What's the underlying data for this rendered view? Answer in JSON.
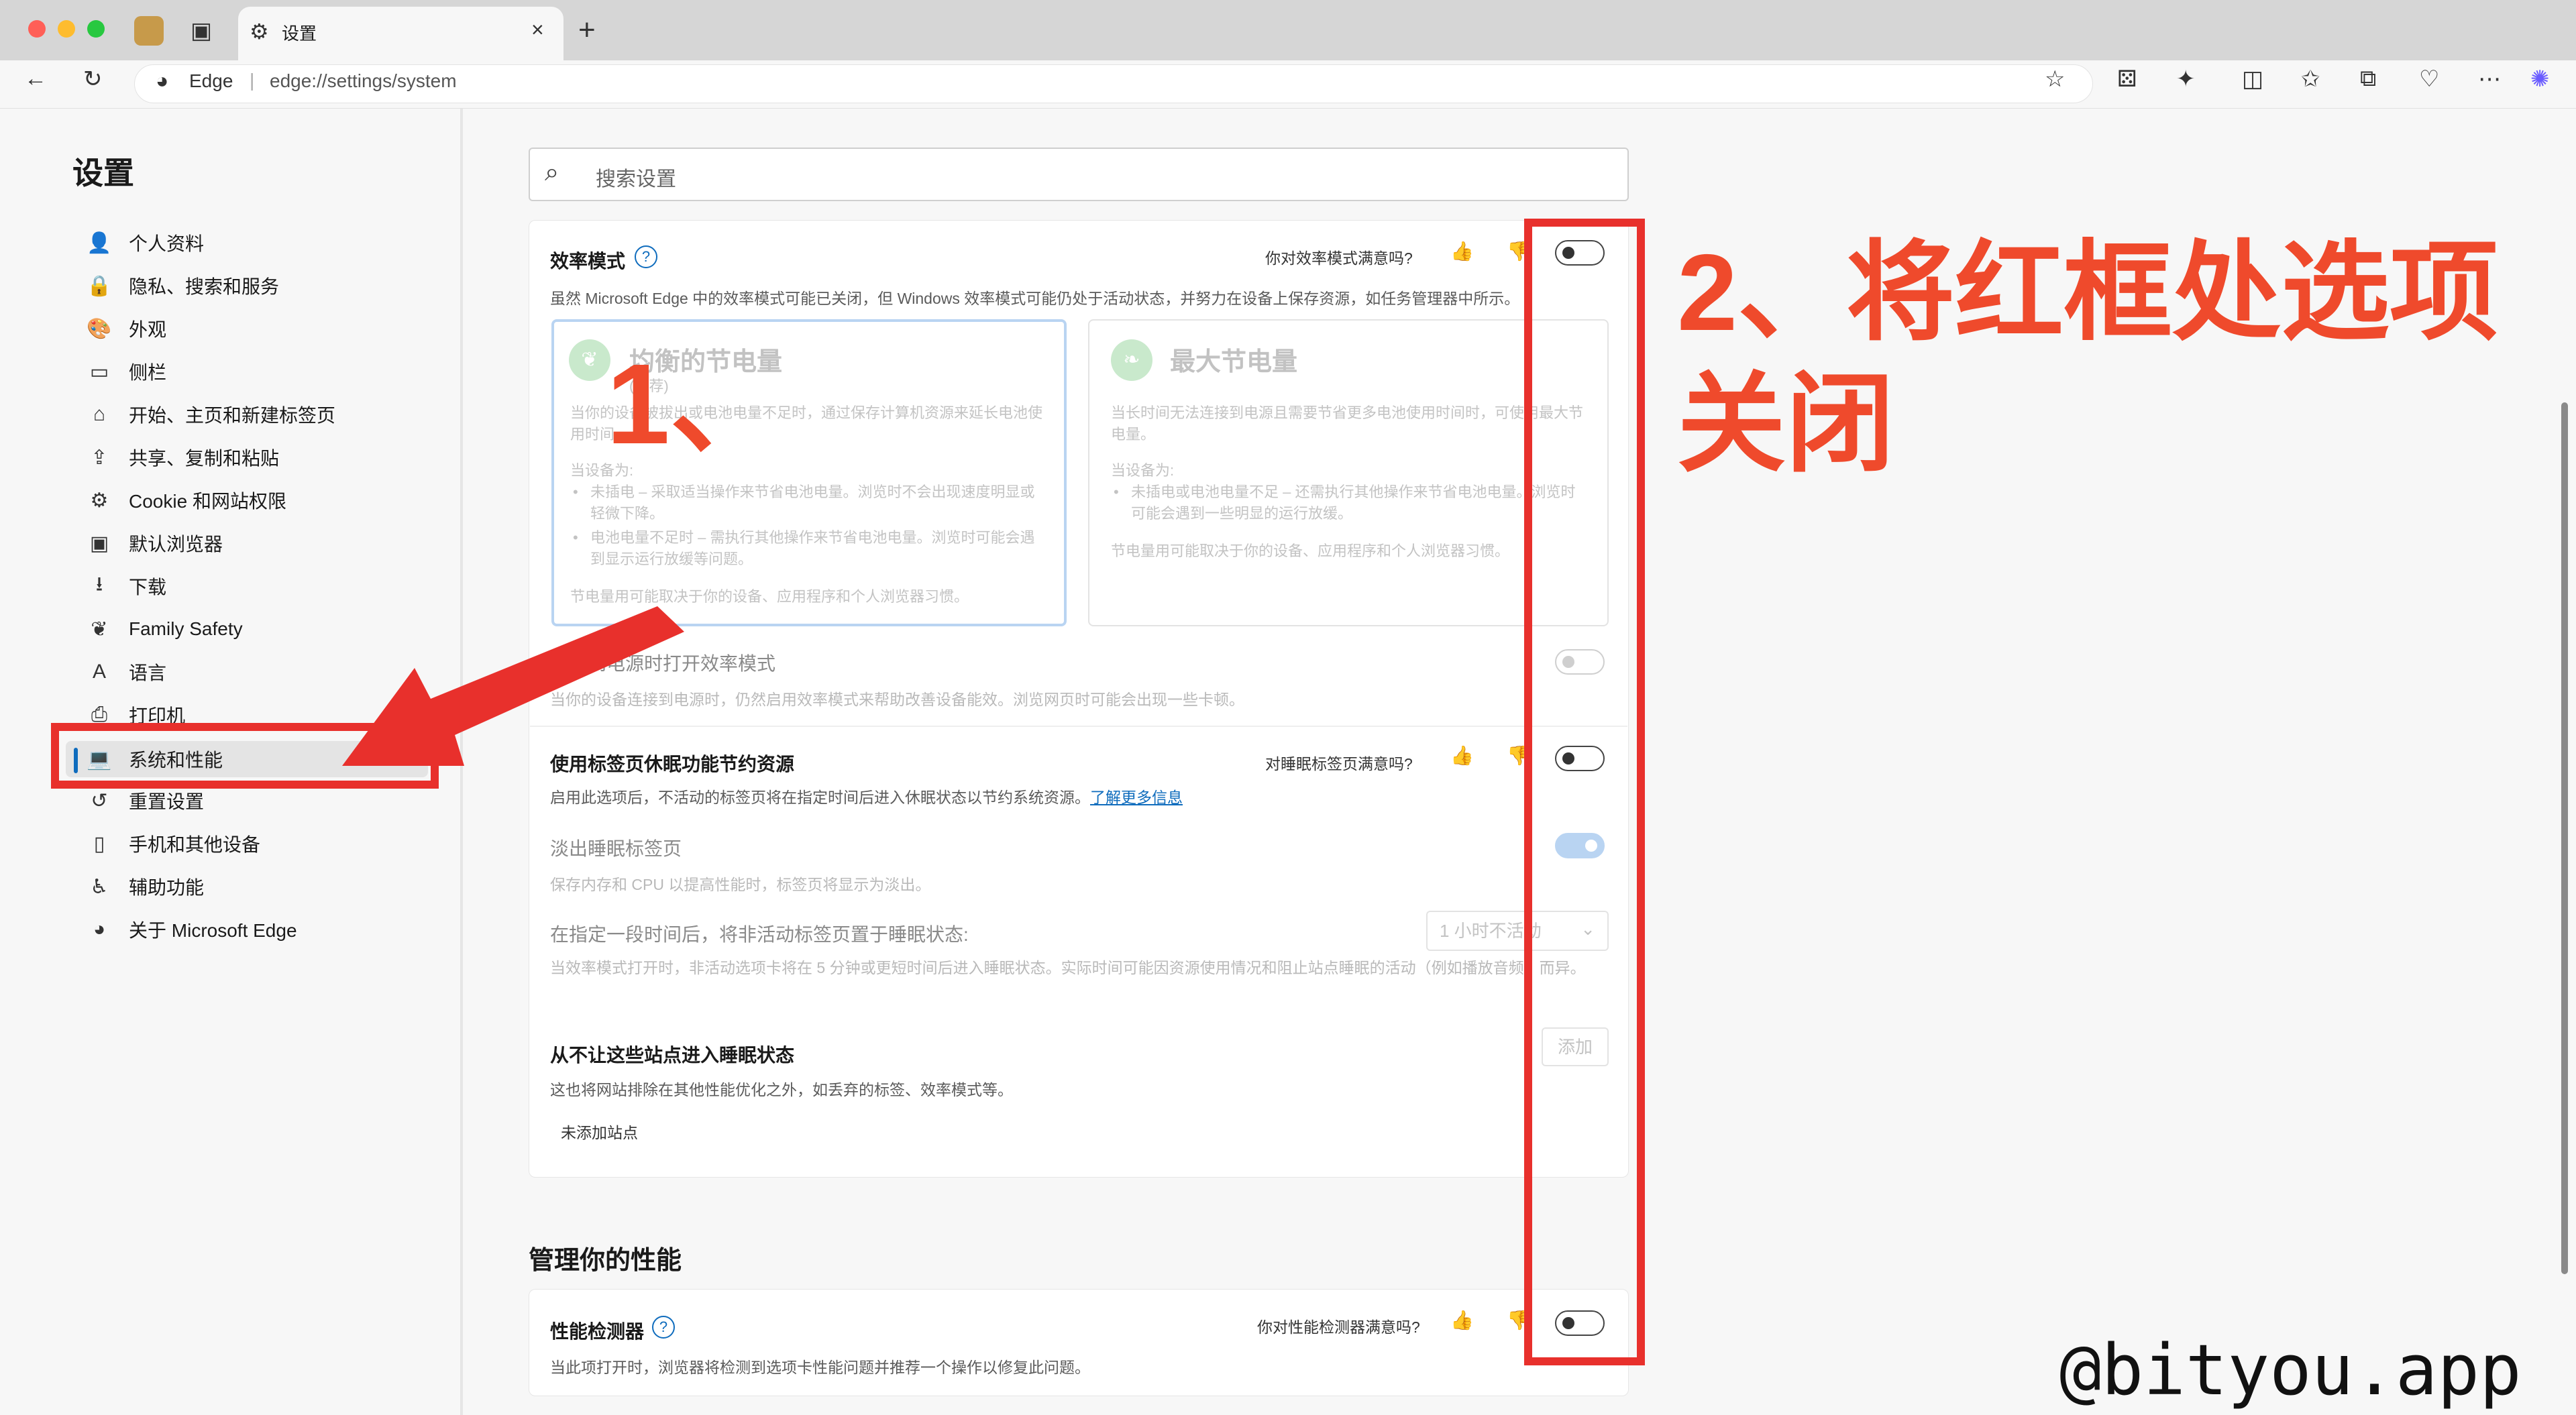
{
  "browser": {
    "tab_title": "设置",
    "tab_close": "×",
    "new_tab": "+",
    "address_label": "Edge",
    "address_separator": "|",
    "address_url": "edge://settings/system"
  },
  "sidebar": {
    "title": "设置",
    "items": [
      {
        "label": "个人资料",
        "icon": "👤"
      },
      {
        "label": "隐私、搜索和服务",
        "icon": "🔒"
      },
      {
        "label": "外观",
        "icon": "🎨"
      },
      {
        "label": "侧栏",
        "icon": "▭"
      },
      {
        "label": "开始、主页和新建标签页",
        "icon": "⌂"
      },
      {
        "label": "共享、复制和粘贴",
        "icon": "⇪"
      },
      {
        "label": "Cookie 和网站权限",
        "icon": "⚙"
      },
      {
        "label": "默认浏览器",
        "icon": "▣"
      },
      {
        "label": "下载",
        "icon": "⭳"
      },
      {
        "label": "Family Safety",
        "icon": "❦"
      },
      {
        "label": "语言",
        "icon": "A"
      },
      {
        "label": "打印机",
        "icon": "⎙"
      },
      {
        "label": "系统和性能",
        "icon": "💻"
      },
      {
        "label": "重置设置",
        "icon": "↺"
      },
      {
        "label": "手机和其他设备",
        "icon": "▯"
      },
      {
        "label": "辅助功能",
        "icon": "♿"
      },
      {
        "label": "关于 Microsoft Edge",
        "icon": "◕"
      }
    ]
  },
  "main": {
    "search_placeholder": "搜索设置",
    "efficiency": {
      "title": "效率模式",
      "question": "你对效率模式满意吗?",
      "desc": "虽然 Microsoft Edge 中的效率模式可能已关闭，但 Windows 效率模式可能仍处于活动状态，并努力在设备上保存资源，如任务管理器中所示。",
      "options": [
        {
          "title": "均衡的节电量",
          "subtitle": "(推荐)",
          "desc": "当你的设备被拔出或电池电量不足时，通过保存计算机资源来延长电池使用时间。",
          "list_title": "当设备为:",
          "bullets": [
            "未插电 – 采取适当操作来节省电池电量。浏览时不会出现速度明显或轻微下降。",
            "电池电量不足时 – 需执行其他操作来节省电池电量。浏览时可能会遇到显示运行放缓等问题。"
          ],
          "foot": "节电量用可能取决于你的设备、应用程序和个人浏览器习惯。"
        },
        {
          "title": "最大节电量",
          "subtitle": "",
          "desc": "当长时间无法连接到电源且需要节省更多电池使用时间时，可使用最大节电量。",
          "list_title": "当设备为:",
          "bullets": [
            "未插电或电池电量不足 – 还需执行其他操作来节省电池电量。浏览时可能会遇到一些明显的运行放缓。"
          ],
          "foot": "节电量用可能取决于你的设备、应用程序和个人浏览器习惯。"
        }
      ],
      "power_title": "连接到电源时打开效率模式",
      "power_desc": "当你的设备连接到电源时，仍然启用效率模式来帮助改善设备能效。浏览网页时可能会出现一些卡顿。"
    },
    "sleeping": {
      "title": "使用标签页休眠功能节约资源",
      "question": "对睡眠标签页满意吗?",
      "desc": "启用此选项后，不活动的标签页将在指定时间后进入休眠状态以节约系统资源。",
      "link": "了解更多信息",
      "fade_title": "淡出睡眠标签页",
      "fade_desc": "保存内存和 CPU 以提高性能时，标签页将显示为淡出。",
      "after_title": "在指定一段时间后，将非活动标签页置于睡眠状态:",
      "after_value": "1 小时不活动",
      "after_desc": "当效率模式打开时，非活动选项卡将在 5 分钟或更短时间后进入睡眠状态。实际时间可能因资源使用情况和阻止站点睡眠的活动（例如播放音频）而异。",
      "never_title": "从不让这些站点进入睡眠状态",
      "never_desc": "这也将网站排除在其他性能优化之外，如丢弃的标签、效率模式等。",
      "add_button": "添加",
      "no_sites": "未添加站点"
    },
    "perf_section_title": "管理你的性能",
    "perf_detector": {
      "title": "性能检测器",
      "question": "你对性能检测器满意吗?",
      "desc": "当此项打开时，浏览器将检测到选项卡性能问题并推荐一个操作以修复此问题。"
    }
  },
  "annotations": {
    "step1": "1、",
    "step2_line1": "2、将红框处选项",
    "step2_line2": "关闭",
    "watermark": "@bityou.app",
    "color": "#e8302c"
  }
}
